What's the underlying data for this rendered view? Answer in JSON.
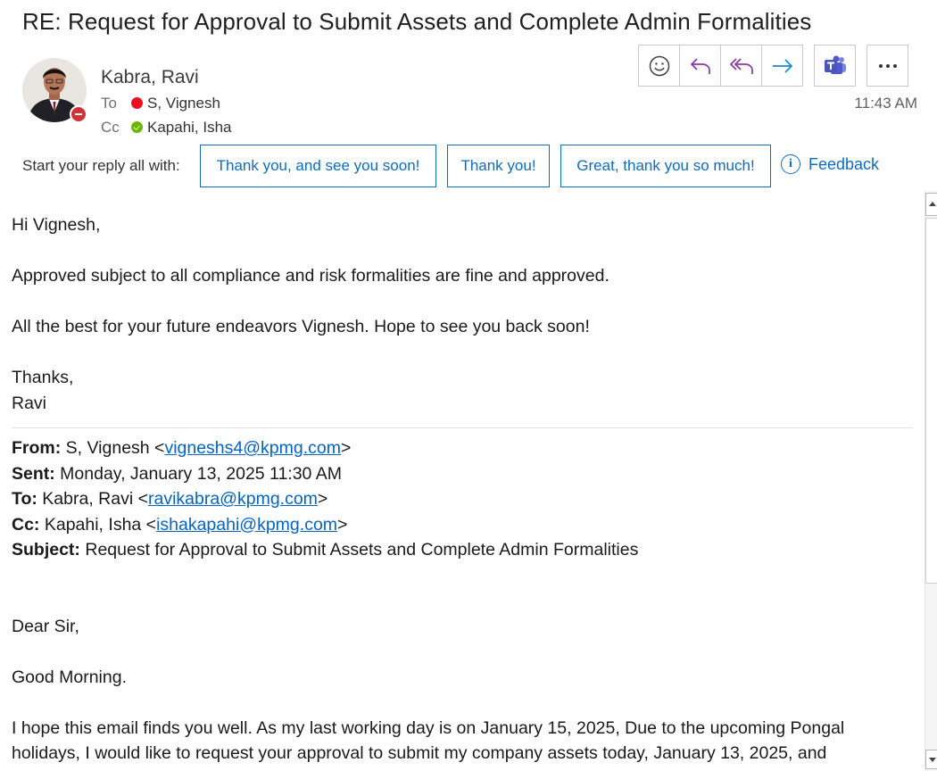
{
  "email": {
    "subject": "RE: Request for Approval to Submit Assets and Complete Admin Formalities",
    "sender": "Kabra, Ravi",
    "to_label": "To",
    "to_name": "S, Vignesh",
    "cc_label": "Cc",
    "cc_name": "Kapahi, Isha",
    "time": "11:43 AM",
    "sender_status_color": "#d13438",
    "to_status_color": "#e81123",
    "cc_status_color": "#6bb700"
  },
  "toolbar": {
    "icons": [
      "emoji-icon",
      "reply-icon",
      "reply-all-icon",
      "forward-icon",
      "teams-icon",
      "more-icon"
    ]
  },
  "quick_reply": {
    "lead": "Start your reply all with:",
    "options": [
      "Thank you, and see you soon!",
      "Thank you!",
      "Great, thank you so much!"
    ],
    "feedback": "Feedback",
    "accent_color": "#0f6cbd"
  },
  "body": {
    "greeting": "Hi Vignesh,",
    "line1": "Approved subject to all compliance and risk formalities are fine and approved.",
    "line2": "All the best for your future endeavors Vignesh. Hope to see you back soon!",
    "signoff": "Thanks,",
    "signature": "Ravi"
  },
  "quoted": {
    "from_label": "From:",
    "from_name": "S, Vignesh <",
    "from_email": "vigneshs4@kpmg.com",
    "sent_label": "Sent:",
    "sent_value": "Monday, January 13, 2025 11:30 AM",
    "to_label": "To:",
    "to_name": "Kabra, Ravi <",
    "to_email": "ravikabra@kpmg.com",
    "cc_label": "Cc:",
    "cc_name": "Kapahi, Isha <",
    "cc_email": "ishakapahi@kpmg.com",
    "close": ">",
    "subject_label": "Subject:",
    "subject_value": "Request for Approval to Submit Assets and Complete Admin Formalities",
    "salutation": "Dear Sir,",
    "morning": "Good Morning.",
    "para1": "I hope this email finds you well. As my last working day is on January 15, 2025, Due to the upcoming Pongal holidays, I would like to request your approval to submit my company assets today, January 13, 2025, and"
  }
}
